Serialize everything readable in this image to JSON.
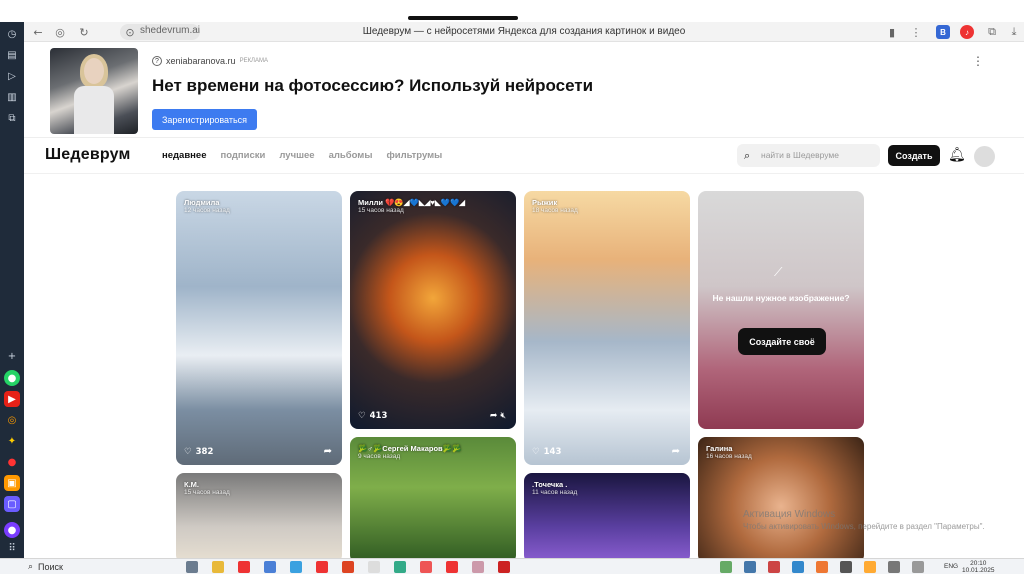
{
  "browser": {
    "url": "shedevrum.ai",
    "page_title": "Шедеврум — с нейросетями Яндекса для создания картинок и видео",
    "extensions": [
      "В",
      "♪"
    ]
  },
  "ad": {
    "domain": "xeniabaranova.ru",
    "tag": "реклама",
    "title": "Нет времени на фотосессию? Используй нейросети",
    "button": "Зарегистрироваться",
    "more": "⋮"
  },
  "header": {
    "logo": "Шедеврум",
    "tabs": [
      {
        "label": "недавнее",
        "active": true
      },
      {
        "label": "подписки",
        "active": false
      },
      {
        "label": "лучшее",
        "active": false
      },
      {
        "label": "альбомы",
        "active": false
      },
      {
        "label": "фильтрумы",
        "active": false
      }
    ],
    "search_placeholder": "найти в Шедевруме",
    "create": "Создать"
  },
  "cards": [
    {
      "author": "Людмила",
      "time": "12 часов назад",
      "likes": "382"
    },
    {
      "author": "Милли 💔😍◢💙◣◢♥◣💙💙◢",
      "time": "15 часов назад",
      "likes": "413"
    },
    {
      "author": "Рыжик",
      "time": "18 часов назад",
      "likes": "143"
    },
    {
      "ask": "Не нашли нужное изображение?",
      "button": "Создайте своё"
    },
    {
      "author": "К.М.",
      "time": "15 часов назад"
    },
    {
      "author": "🥦♂🥦Сергей Макаров🥦🥦",
      "time": "9 часов назад"
    },
    {
      "author": ".Точечка .",
      "time": "11 часов назад"
    },
    {
      "author": "Галина",
      "time": "16 часов назад"
    }
  ],
  "windows": {
    "watermark_title": "Активация Windows",
    "watermark_text": "Чтобы активировать Windows, перейдите в раздел \"Параметры\".",
    "search": "Поиск",
    "lang": "ENG",
    "time": "20:10",
    "date": "10.01.2025"
  }
}
